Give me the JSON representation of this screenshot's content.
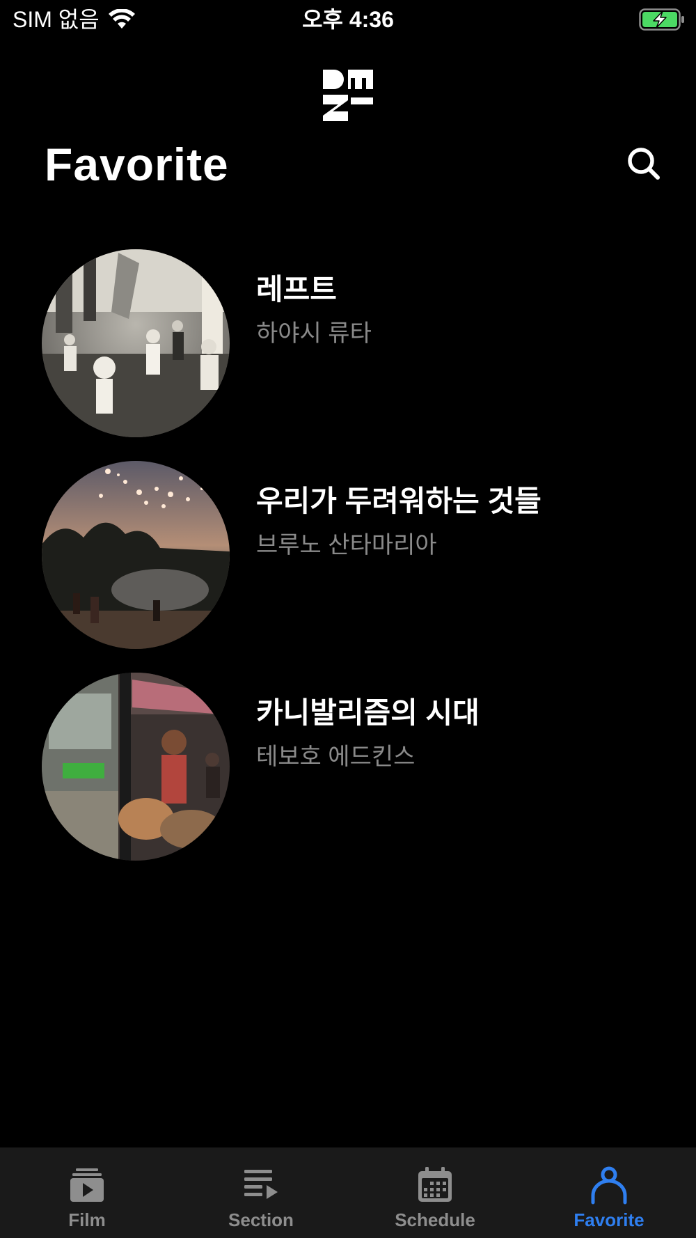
{
  "status_bar": {
    "carrier": "SIM 없음",
    "time": "오후 4:36",
    "icons": [
      "wifi-icon",
      "battery-charging-icon"
    ]
  },
  "header": {
    "logo": "dmz-logo",
    "title": "Favorite",
    "search_icon": "search-icon"
  },
  "favorites": [
    {
      "title": "레프트",
      "director": "하야시 류타"
    },
    {
      "title": "우리가 두려워하는 것들",
      "director": "브루노 산타마리아"
    },
    {
      "title": "카니발리즘의 시대",
      "director": "테보호 에드킨스"
    }
  ],
  "tab_bar": {
    "tabs": [
      {
        "label": "Film",
        "icon": "film-icon",
        "active": false
      },
      {
        "label": "Section",
        "icon": "section-list-icon",
        "active": false
      },
      {
        "label": "Schedule",
        "icon": "calendar-icon",
        "active": false
      },
      {
        "label": "Favorite",
        "icon": "person-icon",
        "active": true
      }
    ]
  },
  "colors": {
    "background": "#000000",
    "tab_bar_background": "#1a1a1a",
    "active_tab": "#2f7ff0",
    "inactive_tab": "#8e8e8e",
    "subtitle": "#8a8a8a",
    "battery": "#4cd964"
  }
}
